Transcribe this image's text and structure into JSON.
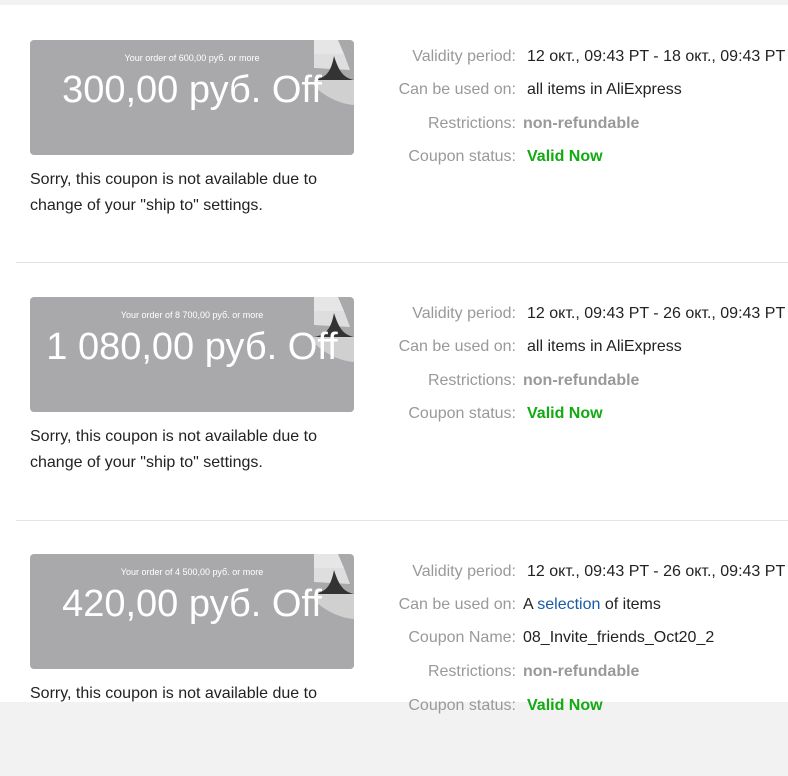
{
  "coupons": [
    {
      "condition": "Your order of 600,00 руб. or more",
      "amount": "300,00 руб. Off",
      "note": "Sorry, this coupon is not available due to change of your \"ship to\" settings.",
      "validity_label": "Validity period:",
      "validity_value": "12 окт., 09:43 PT - 18 окт., 09:43 PT",
      "usage_label": "Can be used on:",
      "usage_value": "all items in AliExpress",
      "restrictions_label": "Restrictions:",
      "restrictions_value": "non-refundable",
      "status_label": "Coupon status:",
      "status_value": "Valid Now"
    },
    {
      "condition": "Your order of 8 700,00 руб. or more",
      "amount": "1 080,00 руб. Off",
      "note": "Sorry, this coupon is not available due to change of your \"ship to\" settings.",
      "validity_label": "Validity period:",
      "validity_value": "12 окт., 09:43 PT - 26 окт., 09:43 PT",
      "usage_label": "Can be used on:",
      "usage_value": "all items in AliExpress",
      "restrictions_label": "Restrictions:",
      "restrictions_value": "non-refundable",
      "status_label": "Coupon status:",
      "status_value": "Valid Now"
    },
    {
      "condition": "Your order of 4 500,00 руб. or more",
      "amount": "420,00 руб. Off",
      "note": "Sorry, this coupon is not available due to",
      "validity_label": "Validity period:",
      "validity_value": "12 окт., 09:43 PT - 26 окт., 09:43 PT",
      "usage_label": "Can be used on:",
      "usage_prefix": "A",
      "usage_link": "selection",
      "usage_suffix": "of items",
      "name_label": "Coupon Name:",
      "name_value": "08_Invite_friends_Oct20_2",
      "restrictions_label": "Restrictions:",
      "restrictions_value": "non-refundable",
      "status_label": "Coupon status:",
      "status_value": "Valid Now"
    }
  ],
  "colors": {
    "card_bg": "#a9a9ab",
    "label_gray": "#999999",
    "valid_green": "#11aa11",
    "link_blue": "#1a5ba6"
  }
}
